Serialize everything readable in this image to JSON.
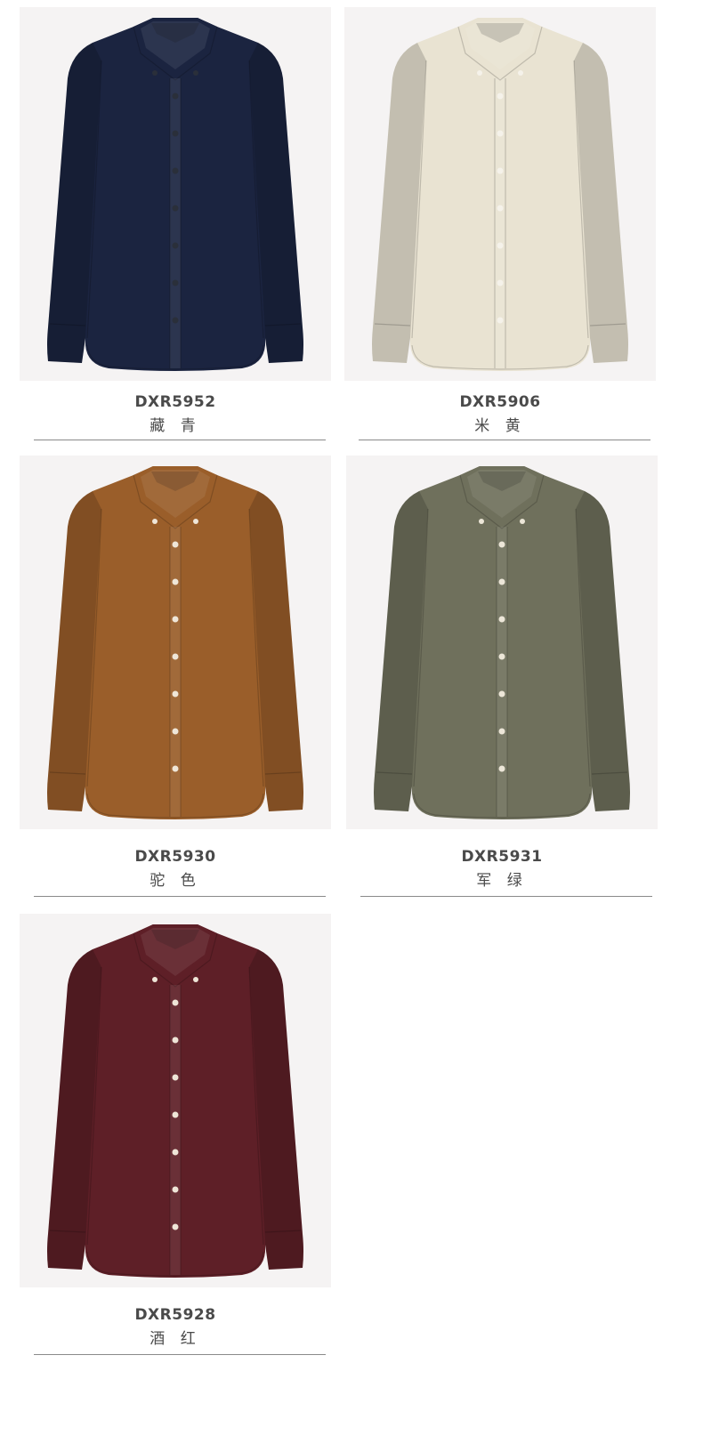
{
  "products": [
    {
      "code": "DXR5952",
      "color_name": "藏 青",
      "shirt_color": "#1b2440",
      "button_color": "#2a2f3a"
    },
    {
      "code": "DXR5906",
      "color_name": "米 黄",
      "shirt_color": "#e9e3d2",
      "button_color": "#f5f2ea"
    },
    {
      "code": "DXR5930",
      "color_name": "驼 色",
      "shirt_color": "#9a5e2a",
      "button_color": "#efe6d8"
    },
    {
      "code": "DXR5931",
      "color_name": "军 绿",
      "shirt_color": "#6f705c",
      "button_color": "#ece6d8"
    },
    {
      "code": "DXR5928",
      "color_name": "酒 红",
      "shirt_color": "#5e1f27",
      "button_color": "#efe6d8"
    }
  ]
}
